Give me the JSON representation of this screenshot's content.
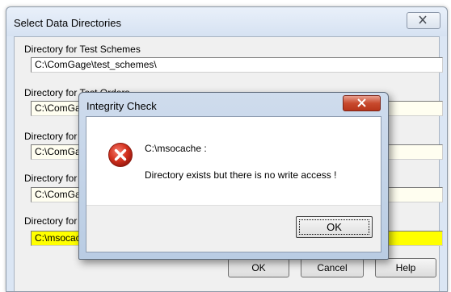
{
  "main_window": {
    "title": "Select Data Directories",
    "fields": [
      {
        "label": "Directory for Test Schemes",
        "value": "C:\\ComGage\\test_schemes\\"
      },
      {
        "label": "Directory for Test Orders",
        "value": "C:\\ComGa"
      },
      {
        "label": "Directory for",
        "value": "C:\\ComGa"
      },
      {
        "label": "Directory for",
        "value": "C:\\ComGa"
      },
      {
        "label": "Directory for",
        "value": "C:\\msocac"
      }
    ],
    "buttons": {
      "ok": "OK",
      "cancel": "Cancel",
      "help": "Help"
    }
  },
  "dialog": {
    "title": "Integrity Check",
    "path": "C:\\msocache :",
    "message": "Directory exists but there is no write access !",
    "ok": "OK"
  },
  "colors": {
    "highlight": "#ffff00",
    "error": "#c4281c",
    "close_red": "#c84a2e"
  },
  "icons": {
    "dialog": "error-icon",
    "close": "close-icon"
  }
}
